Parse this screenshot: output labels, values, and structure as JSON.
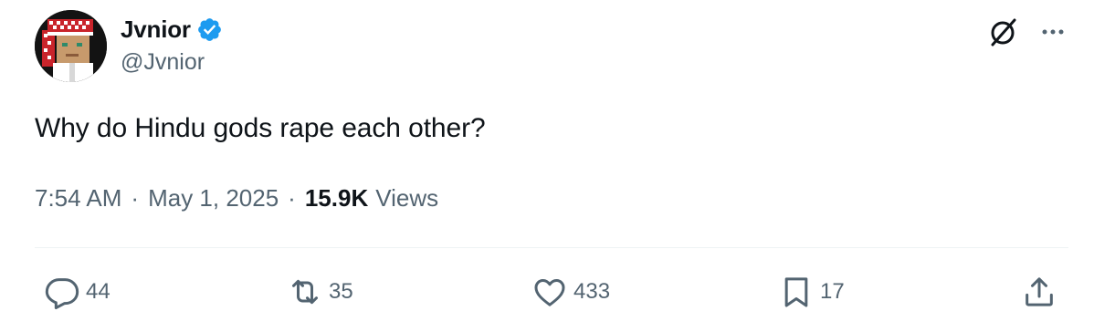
{
  "author": {
    "display_name": "Jvnior",
    "handle": "@Jvnior",
    "verified_color": "#1d9bf0"
  },
  "tweet": {
    "text": "Why do Hindu gods rape each other?"
  },
  "meta": {
    "time": "7:54 AM",
    "separator": "·",
    "date": "May 1, 2025",
    "views_count": "15.9K",
    "views_label": "Views"
  },
  "actions": {
    "replies": "44",
    "reposts": "35",
    "likes": "433",
    "bookmarks": "17"
  },
  "icons": {
    "top": [
      "grok-icon",
      "more-icon"
    ],
    "actions": [
      "reply-icon",
      "repost-icon",
      "like-icon",
      "bookmark-icon",
      "share-icon"
    ]
  },
  "colors": {
    "text_primary": "#0f1419",
    "text_secondary": "#536471",
    "divider": "#eff3f4"
  }
}
